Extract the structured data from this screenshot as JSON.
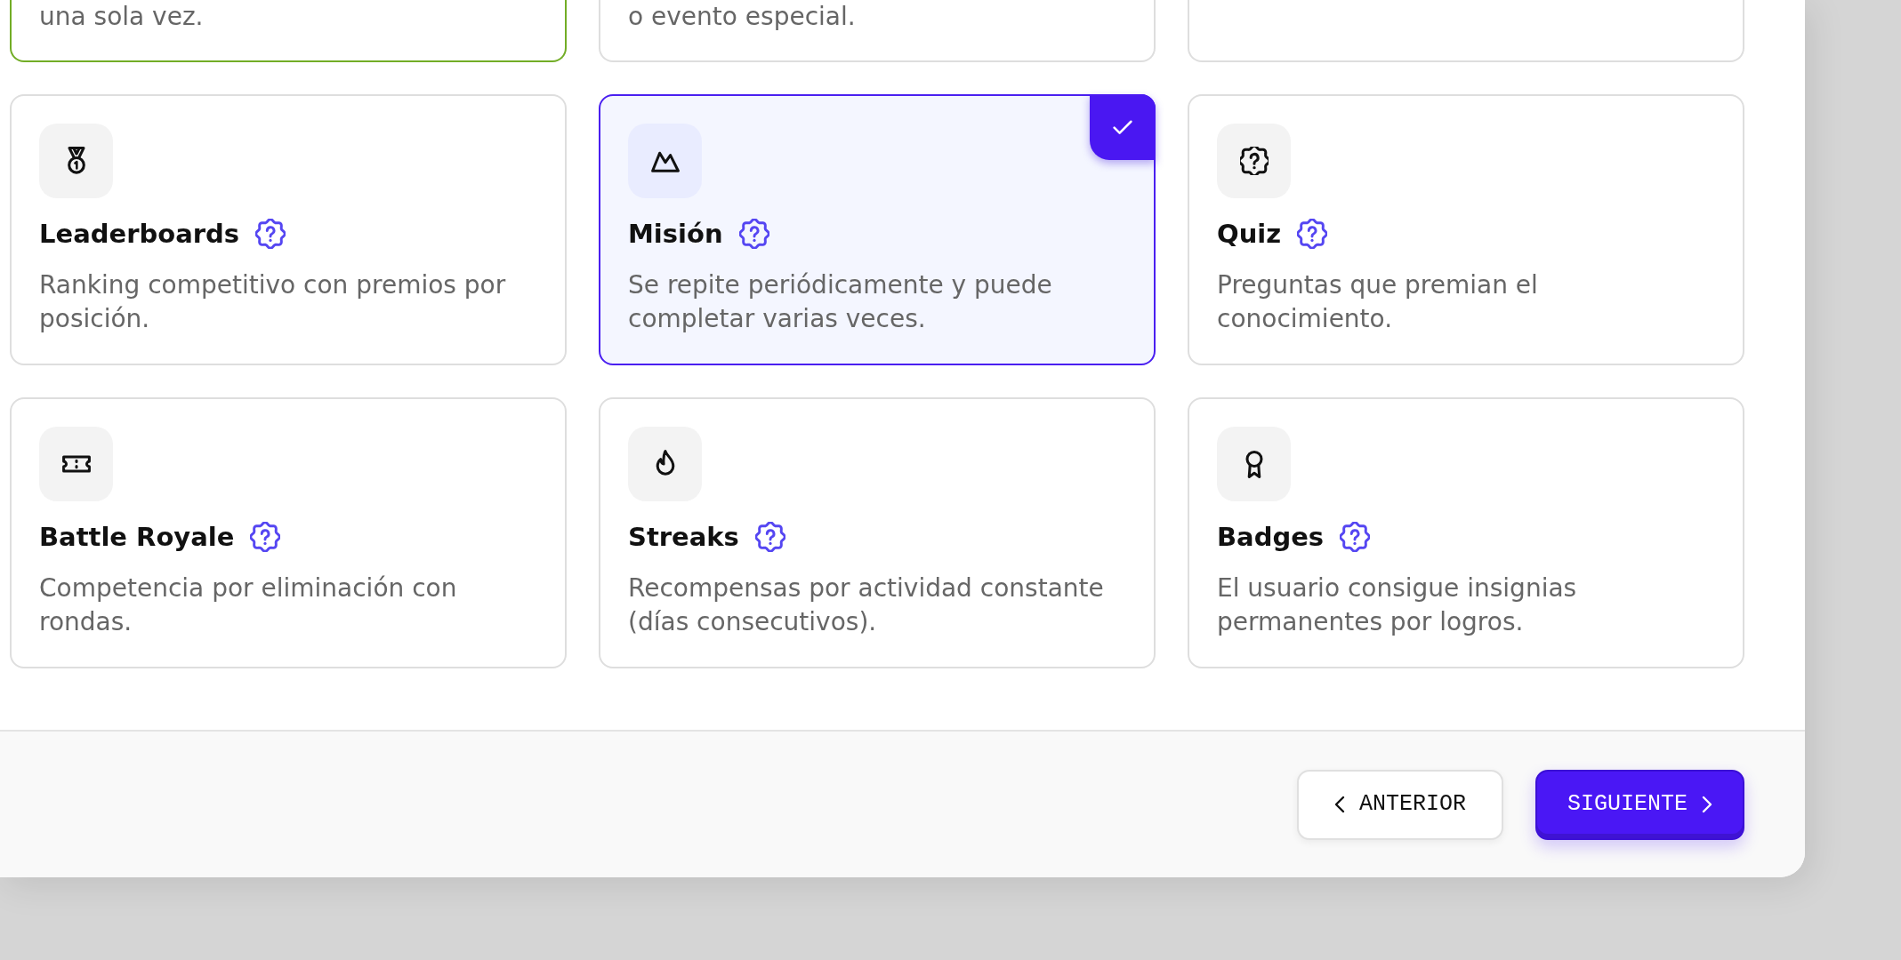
{
  "cards": [
    {
      "kind": "partial",
      "description": "una sola vez.",
      "selected": false,
      "highlighted": true
    },
    {
      "kind": "partial",
      "description": "o evento especial.",
      "selected": false,
      "highlighted": false
    },
    {
      "kind": "partial",
      "selected": false,
      "highlighted": false
    },
    {
      "kind": "full",
      "title": "Leaderboards",
      "description": "Ranking competitivo con premios por posición.",
      "selected": false,
      "highlighted": false
    },
    {
      "kind": "full",
      "title": "Misión",
      "description": "Se repite periódicamente y puede completar varias veces.",
      "selected": true,
      "highlighted": false
    },
    {
      "kind": "full",
      "title": "Quiz",
      "description": "Preguntas que premian el conocimiento.",
      "selected": false,
      "highlighted": false
    },
    {
      "kind": "full",
      "title": "Battle Royale",
      "description": "Competencia por eliminación con rondas.",
      "selected": false,
      "highlighted": false
    },
    {
      "kind": "full",
      "title": "Streaks",
      "description": "Recompensas por actividad constante (días consecutivos).",
      "selected": false,
      "highlighted": false
    },
    {
      "kind": "full",
      "title": "Badges",
      "description": "El usuario consigue insignias permanentes por logros.",
      "selected": false,
      "highlighted": false
    }
  ],
  "footer": {
    "buttons": [
      {
        "kind": "previous",
        "label": "ANTERIOR"
      },
      {
        "kind": "next",
        "label": "SIGUIENTE"
      }
    ]
  }
}
